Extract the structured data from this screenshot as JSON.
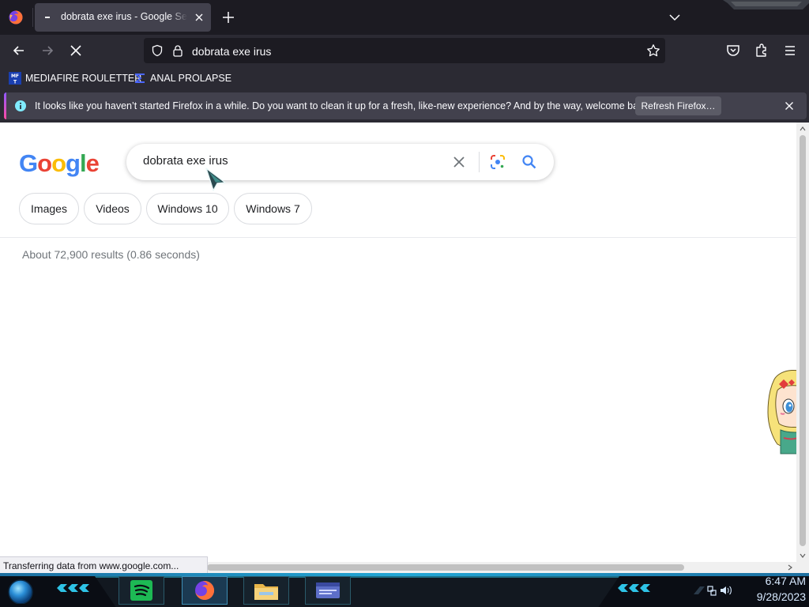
{
  "browser": {
    "tab": {
      "title": "dobrata exe irus - Google Search"
    },
    "url": "dobrata exe irus",
    "bookmarks": [
      {
        "label": "MEDIAFIRE ROULETTER",
        "icon": "mediafire-icon"
      },
      {
        "label": "ANAL PROLAPSE",
        "icon": "sigma-icon"
      }
    ],
    "notification": {
      "message": "It looks like you haven’t started Firefox in a while. Do you want to clean it up for a fresh, like-new experience? And by the way, welcome back!",
      "button": "Refresh Firefox…"
    },
    "status": "Transferring data from www.google.com..."
  },
  "google": {
    "logo_letters": [
      "G",
      "o",
      "o",
      "g",
      "l",
      "e"
    ],
    "logo_colors": [
      "#4285f4",
      "#ea4335",
      "#fbbc05",
      "#4285f4",
      "#34a853",
      "#ea4335"
    ],
    "query": "dobrata exe irus",
    "chips": [
      "Images",
      "Videos",
      "Windows 10",
      "Windows 7"
    ],
    "stats": "About 72,900 results (0.86 seconds)"
  },
  "taskbar": {
    "time": "6:47 AM",
    "date": "9/28/2023",
    "apps": [
      "spotify-icon",
      "firefox-icon",
      "file-explorer-icon",
      "window-app-icon"
    ]
  },
  "colors": {
    "chrome_dark": "#1c1b22",
    "chrome": "#2b2a33",
    "google_blue": "#4285f4",
    "taskbar_accent": "#23a7d6"
  }
}
